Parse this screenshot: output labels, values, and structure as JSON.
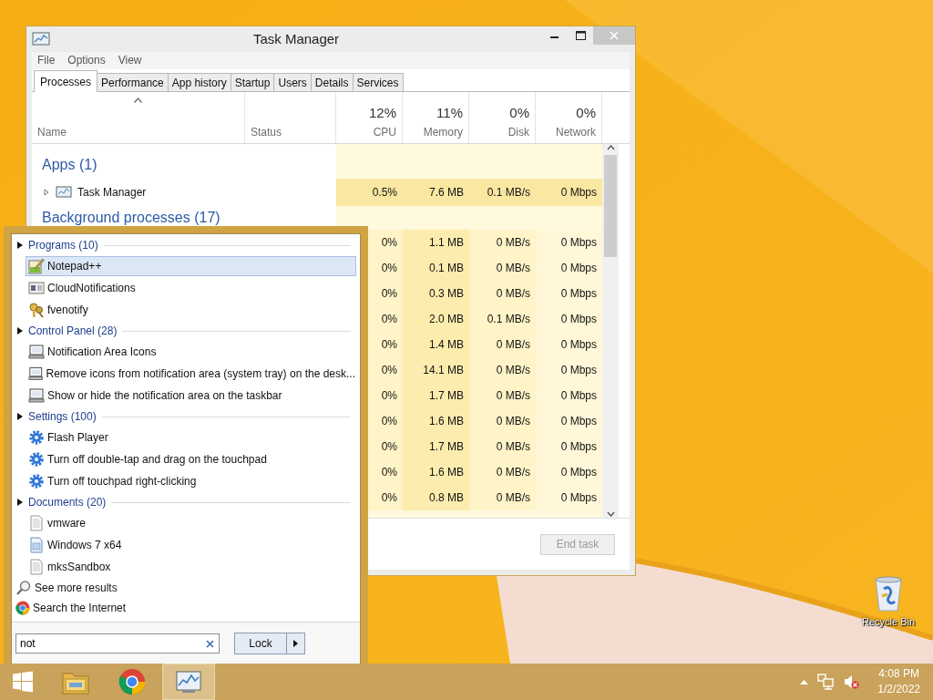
{
  "task_manager": {
    "title": "Task Manager",
    "menu": [
      "File",
      "Options",
      "View"
    ],
    "tabs": [
      {
        "label": "Processes",
        "selected": true
      },
      {
        "label": "Performance",
        "selected": false
      },
      {
        "label": "App history",
        "selected": false
      },
      {
        "label": "Startup",
        "selected": false
      },
      {
        "label": "Users",
        "selected": false
      },
      {
        "label": "Details",
        "selected": false
      },
      {
        "label": "Services",
        "selected": false
      }
    ],
    "columns": {
      "name": {
        "label": "Name",
        "sorted": true
      },
      "status": {
        "label": "Status"
      },
      "cpu": {
        "total": "12%",
        "label": "CPU"
      },
      "memory": {
        "total": "11%",
        "label": "Memory"
      },
      "disk": {
        "total": "0%",
        "label": "Disk"
      },
      "network": {
        "total": "0%",
        "label": "Network"
      }
    },
    "groups": [
      {
        "label": "Apps (1)",
        "rows": [
          {
            "name": "Task Manager",
            "expanded": false,
            "cpu": "0.5%",
            "memory": "7.6 MB",
            "disk": "0.1 MB/s",
            "network": "0 Mbps"
          }
        ]
      },
      {
        "label": "Background processes (17)",
        "rows": [
          {
            "cpu": "0%",
            "memory": "1.1 MB",
            "disk": "0 MB/s",
            "network": "0 Mbps"
          },
          {
            "cpu": "0%",
            "memory": "0.1 MB",
            "disk": "0 MB/s",
            "network": "0 Mbps"
          },
          {
            "cpu": "0%",
            "memory": "0.3 MB",
            "disk": "0 MB/s",
            "network": "0 Mbps"
          },
          {
            "cpu": "0%",
            "memory": "2.0 MB",
            "disk": "0.1 MB/s",
            "network": "0 Mbps"
          },
          {
            "cpu": "0%",
            "memory": "1.4 MB",
            "disk": "0 MB/s",
            "network": "0 Mbps"
          },
          {
            "cpu": "0%",
            "memory": "14.1 MB",
            "disk": "0 MB/s",
            "network": "0 Mbps"
          },
          {
            "cpu": "0%",
            "memory": "1.7 MB",
            "disk": "0 MB/s",
            "network": "0 Mbps"
          },
          {
            "cpu": "0%",
            "memory": "1.6 MB",
            "disk": "0 MB/s",
            "network": "0 Mbps"
          },
          {
            "cpu": "0%",
            "memory": "1.7 MB",
            "disk": "0 MB/s",
            "network": "0 Mbps"
          },
          {
            "cpu": "0%",
            "memory": "1.6 MB",
            "disk": "0 MB/s",
            "network": "0 Mbps"
          },
          {
            "cpu": "0%",
            "memory": "0.8 MB",
            "disk": "0 MB/s",
            "network": "0 Mbps"
          }
        ]
      }
    ],
    "end_task": {
      "label": "End task",
      "disabled": true
    }
  },
  "search_menu": {
    "groups": [
      {
        "label": "Programs (10)",
        "items": [
          {
            "label": "Notepad++",
            "kind": "notepad",
            "selected": true
          },
          {
            "label": "CloudNotifications",
            "kind": "window",
            "selected": false
          },
          {
            "label": "fvenotify",
            "kind": "keys",
            "selected": false
          }
        ]
      },
      {
        "label": "Control Panel (28)",
        "items": [
          {
            "label": "Notification Area Icons",
            "kind": "monitor",
            "selected": false
          },
          {
            "label": "Remove icons from notification area (system tray) on the desk...",
            "kind": "monitor",
            "selected": false
          },
          {
            "label": "Show or hide the notification area on the taskbar",
            "kind": "monitor",
            "selected": false
          }
        ]
      },
      {
        "label": "Settings (100)",
        "items": [
          {
            "label": "Flash Player",
            "kind": "gear",
            "selected": false
          },
          {
            "label": "Turn off double-tap and drag on the touchpad",
            "kind": "gear",
            "selected": false
          },
          {
            "label": "Turn off touchpad right-clicking",
            "kind": "gear",
            "selected": false
          }
        ]
      },
      {
        "label": "Documents (20)",
        "items": [
          {
            "label": "vmware",
            "kind": "doc",
            "selected": false
          },
          {
            "label": "Windows 7 x64",
            "kind": "imagedoc",
            "selected": false
          },
          {
            "label": "mksSandbox",
            "kind": "doc",
            "selected": false
          }
        ]
      }
    ],
    "links": [
      {
        "label": "See more results",
        "kind": "search"
      },
      {
        "label": "Search the Internet",
        "kind": "browser"
      }
    ],
    "search_field": {
      "value": "not"
    },
    "power_button": {
      "label": "Lock"
    }
  },
  "desktop_icons": [
    {
      "label": "Recycle Bin"
    }
  ],
  "taskbar": {
    "apps": [
      {
        "kind": "explorer",
        "selected": false
      },
      {
        "kind": "browser",
        "selected": false
      },
      {
        "kind": "taskmgr",
        "selected": true
      }
    ],
    "time": "4:08 PM",
    "date": "1/2/2022"
  }
}
